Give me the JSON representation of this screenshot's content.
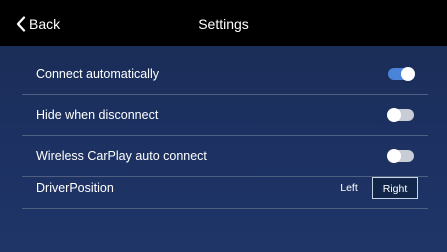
{
  "header": {
    "back_label": "Back",
    "title": "Settings"
  },
  "settings": {
    "connect_automatically": {
      "label": "Connect automatically",
      "enabled": true
    },
    "hide_when_disconnect": {
      "label": "Hide when disconnect",
      "enabled": false
    },
    "wireless_carplay_auto_connect": {
      "label": "Wireless CarPlay auto connect",
      "enabled": false
    },
    "driver_position": {
      "label": "DriverPosition",
      "options": [
        "Left",
        "Right"
      ],
      "selected": "Right"
    }
  },
  "colors": {
    "toggle_on": "#4a84d8",
    "toggle_off": "#c8ccd4",
    "background": "#1c3060",
    "header": "#000000"
  }
}
